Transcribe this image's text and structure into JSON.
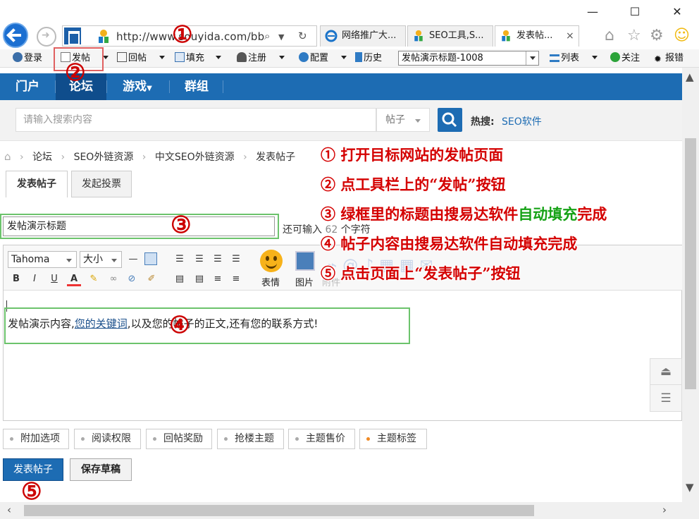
{
  "browser": {
    "url": "http://www.souyida.com/bb",
    "tabs": [
      {
        "label": "网络推广大..."
      },
      {
        "label": "SEO工具,S..."
      },
      {
        "label": "发表帖..."
      }
    ],
    "tab_close": "×"
  },
  "toolbar": {
    "login": "登录",
    "post": "发帖",
    "reply": "回帖",
    "fill": "填充",
    "register": "注册",
    "config": "配置",
    "history": "历史",
    "title_select": "发帖演示标题-1008",
    "list": "列表",
    "follow": "关注",
    "report": "报错"
  },
  "site_nav": {
    "items": [
      "门户",
      "论坛",
      "游戏",
      "群组"
    ]
  },
  "search": {
    "placeholder": "请输入搜索内容",
    "type": "帖子",
    "hot_label": "热搜:",
    "hot_link": "SEO软件"
  },
  "breadcrumb": [
    "论坛",
    "SEO外链资源",
    "中文SEO外链资源",
    "发表帖子"
  ],
  "post_tabs": [
    "发表帖子",
    "发起投票"
  ],
  "title_field": {
    "value": "发帖演示标题",
    "remain_prefix": "还可输入",
    "remain_count": "62",
    "remain_suffix": "个字符"
  },
  "editor": {
    "font": "Tahoma",
    "size": "大小",
    "emoji_label": "表情",
    "image_label": "图片",
    "attach_label": "附件",
    "content_before": "发帖演示内容,",
    "content_link": "您的关键词",
    "content_after": ",以及您的帖子的正文,还有您的联系方式!"
  },
  "options": [
    "附加选项",
    "阅读权限",
    "回帖奖励",
    "抢楼主题",
    "主题售价",
    "主题标签"
  ],
  "buttons": {
    "submit": "发表帖子",
    "draft": "保存草稿"
  },
  "annotations": {
    "markers": [
      "①",
      "②",
      "③",
      "④",
      "⑤"
    ],
    "steps": [
      {
        "num": "①",
        "text": "打开目标网站的发帖页面"
      },
      {
        "num": "②",
        "text": "点工具栏上的“发帖”按钮"
      },
      {
        "num": "③",
        "pre": "绿框里的标题由搜易达软件",
        "green": "自动填充",
        "post": "完成"
      },
      {
        "num": "④",
        "text": "帖子内容由搜易达软件自动填充完成"
      },
      {
        "num": "⑤",
        "text": "点击页面上“发表帖子”按钮"
      }
    ]
  },
  "colors": {
    "brand_blue": "#1d6cb3",
    "annotation_red": "#d40000",
    "highlight_green": "#6cc36c"
  }
}
